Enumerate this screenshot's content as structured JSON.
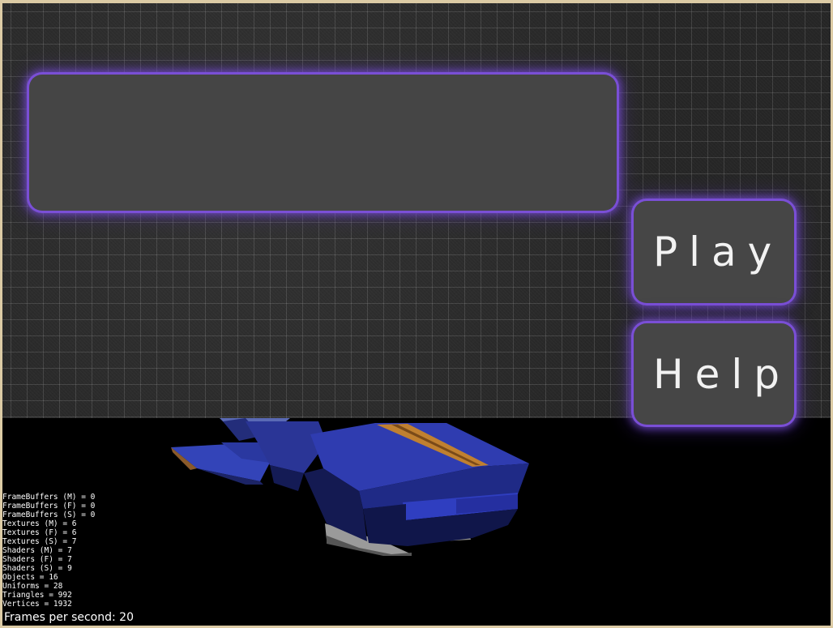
{
  "title_panel": {
    "text": ""
  },
  "menu": {
    "play_label": "Play",
    "help_label": "Help"
  },
  "stats": [
    "FrameBuffers (M) = 0",
    "FrameBuffers (F) = 0",
    "FrameBuffers (S) = 0",
    "Textures (M) = 6",
    "Textures (F) = 6",
    "Textures (S) = 7",
    "Shaders (M) = 7",
    "Shaders (F) = 7",
    "Shaders (S) = 9",
    "Objects = 16",
    "Uniforms = 28",
    "Triangles = 992",
    "Vertices = 1932"
  ],
  "fps_text": "Frames per second: 20",
  "colors": {
    "button_glow": "#7a4fd6",
    "button_fill": "#464646",
    "ship_body": "#2e3aa8",
    "ship_stripe": "#c08030"
  }
}
